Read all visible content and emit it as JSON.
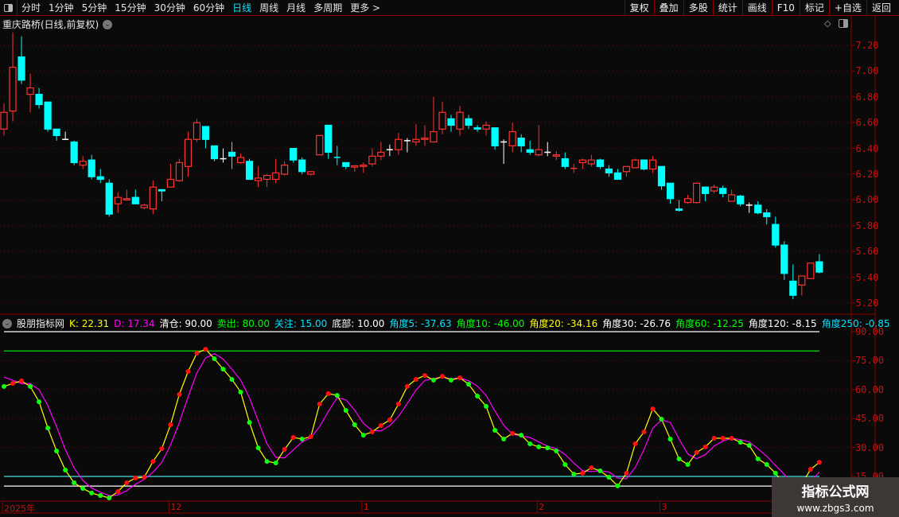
{
  "toolbar": {
    "periods": [
      "分时",
      "1分钟",
      "5分钟",
      "15分钟",
      "30分钟",
      "60分钟",
      "日线",
      "周线",
      "月线",
      "多周期",
      "更多 >"
    ],
    "active_index": 6,
    "right_buttons": [
      "复权",
      "叠加",
      "多股",
      "统计",
      "画线",
      "F10",
      "标记",
      "+自选",
      "返回"
    ]
  },
  "title": {
    "text": "重庆路桥(日线,前复权)"
  },
  "indicator": {
    "name": "股朋指标网",
    "items": [
      {
        "label": "K: 22.31",
        "color": "#ffff00"
      },
      {
        "label": "D: 17.34",
        "color": "#ff00ff"
      },
      {
        "label": "清仓: 90.00",
        "color": "#ffffff"
      },
      {
        "label": "卖出:",
        "color": "#00ff00",
        "value": "80.00"
      },
      {
        "label": "关注: 15.00",
        "color": "#00e5ff"
      },
      {
        "label": "底部: 10.00",
        "color": "#ffffff"
      },
      {
        "label": "角度5: -37.63",
        "color": "#00e5ff"
      },
      {
        "label": "角度10: -46.00",
        "color": "#00ff00"
      },
      {
        "label": "角度20: -34.16",
        "color": "#ffff00"
      },
      {
        "label": "角度30: -26.76",
        "color": "#ffffff"
      },
      {
        "label": "角度60: -12.25",
        "color": "#00ff00"
      },
      {
        "label": "角度120: -8.15",
        "color": "#ffffff"
      },
      {
        "label": "角度250: -0.85",
        "color": "#00e5ff"
      }
    ]
  },
  "watermark": {
    "line1": "指标公式网",
    "line2": "www.zbgs3.com"
  },
  "colors": {
    "up": "#ff3232",
    "down": "#00ffff",
    "flat": "#ffffff",
    "k": "#ffff00",
    "d": "#ff00ff",
    "grid": "#7a0000"
  },
  "chart_data": [
    {
      "type": "candlestick",
      "title": "重庆路桥(日线,前复权)",
      "ylim": [
        5.15,
        7.35
      ],
      "yticks": [
        "7.20",
        "7.00",
        "6.80",
        "6.60",
        "6.40",
        "6.20",
        "6.00",
        "5.80",
        "5.60",
        "5.40",
        "5.20"
      ],
      "x_labels": [
        {
          "index": 0,
          "text": "2025年"
        },
        {
          "index": 19,
          "text": "12"
        },
        {
          "index": 41,
          "text": "1"
        },
        {
          "index": 61,
          "text": "2"
        },
        {
          "index": 75,
          "text": "3"
        }
      ],
      "ohlc": [
        [
          6.55,
          6.75,
          6.5,
          6.68
        ],
        [
          6.69,
          7.3,
          6.61,
          7.03
        ],
        [
          7.11,
          7.27,
          6.9,
          6.93
        ],
        [
          6.82,
          6.98,
          6.68,
          6.87
        ],
        [
          6.82,
          6.87,
          6.71,
          6.74
        ],
        [
          6.76,
          6.76,
          6.53,
          6.55
        ],
        [
          6.55,
          6.55,
          6.46,
          6.5
        ],
        [
          6.47,
          6.53,
          6.47,
          6.47
        ],
        [
          6.45,
          6.46,
          6.27,
          6.29
        ],
        [
          6.27,
          6.34,
          6.24,
          6.3
        ],
        [
          6.31,
          6.35,
          6.16,
          6.18
        ],
        [
          6.18,
          6.24,
          6.13,
          6.16
        ],
        [
          6.13,
          6.16,
          5.87,
          5.89
        ],
        [
          5.97,
          6.06,
          5.9,
          6.02
        ],
        [
          6.0,
          6.08,
          6.0,
          6.01
        ],
        [
          6.02,
          6.08,
          5.97,
          5.97
        ],
        [
          5.94,
          5.97,
          5.93,
          5.96
        ],
        [
          5.93,
          6.15,
          5.89,
          6.1
        ],
        [
          6.08,
          6.08,
          5.99,
          6.07
        ],
        [
          6.1,
          6.28,
          6.1,
          6.16
        ],
        [
          6.15,
          6.32,
          6.14,
          6.29
        ],
        [
          6.26,
          6.53,
          6.18,
          6.47
        ],
        [
          6.47,
          6.63,
          6.45,
          6.6
        ],
        [
          6.57,
          6.57,
          6.4,
          6.47
        ],
        [
          6.42,
          6.42,
          6.3,
          6.32
        ],
        [
          6.32,
          6.4,
          6.29,
          6.32
        ],
        [
          6.37,
          6.45,
          6.24,
          6.34
        ],
        [
          6.29,
          6.36,
          6.28,
          6.33
        ],
        [
          6.3,
          6.32,
          6.16,
          6.16
        ],
        [
          6.15,
          6.26,
          6.1,
          6.17
        ],
        [
          6.16,
          6.2,
          6.1,
          6.19
        ],
        [
          6.16,
          6.32,
          6.13,
          6.21
        ],
        [
          6.2,
          6.3,
          6.19,
          6.27
        ],
        [
          6.4,
          6.4,
          6.29,
          6.31
        ],
        [
          6.31,
          6.33,
          6.2,
          6.22
        ],
        [
          6.2,
          6.22,
          6.19,
          6.22
        ],
        [
          6.35,
          6.5,
          6.35,
          6.5
        ],
        [
          6.58,
          6.58,
          6.32,
          6.37
        ],
        [
          6.33,
          6.42,
          6.27,
          6.325
        ],
        [
          6.29,
          6.29,
          6.24,
          6.26
        ],
        [
          6.255,
          6.27,
          6.22,
          6.265
        ],
        [
          6.26,
          6.29,
          6.21,
          6.27
        ],
        [
          6.28,
          6.4,
          6.26,
          6.34
        ],
        [
          6.34,
          6.45,
          6.31,
          6.37
        ],
        [
          6.39,
          6.43,
          6.34,
          6.39
        ],
        [
          6.39,
          6.52,
          6.35,
          6.47
        ],
        [
          6.46,
          6.48,
          6.37,
          6.46
        ],
        [
          6.45,
          6.59,
          6.42,
          6.47
        ],
        [
          6.47,
          6.58,
          6.42,
          6.48
        ],
        [
          6.45,
          6.8,
          6.45,
          6.53
        ],
        [
          6.55,
          6.76,
          6.51,
          6.68
        ],
        [
          6.63,
          6.66,
          6.53,
          6.58
        ],
        [
          6.55,
          6.73,
          6.5,
          6.68
        ],
        [
          6.63,
          6.66,
          6.55,
          6.58
        ],
        [
          6.56,
          6.58,
          6.53,
          6.55
        ],
        [
          6.55,
          6.61,
          6.5,
          6.58
        ],
        [
          6.56,
          6.56,
          6.39,
          6.42
        ],
        [
          6.45,
          6.47,
          6.28,
          6.45
        ],
        [
          6.42,
          6.6,
          6.37,
          6.53
        ],
        [
          6.48,
          6.51,
          6.37,
          6.42
        ],
        [
          6.39,
          6.46,
          6.35,
          6.37
        ],
        [
          6.35,
          6.58,
          6.34,
          6.39
        ],
        [
          6.37,
          6.45,
          6.34,
          6.37
        ],
        [
          6.34,
          6.38,
          6.31,
          6.35
        ],
        [
          6.32,
          6.37,
          6.24,
          6.26
        ],
        [
          6.24,
          6.28,
          6.21,
          6.245
        ],
        [
          6.29,
          6.32,
          6.24,
          6.31
        ],
        [
          6.28,
          6.35,
          6.26,
          6.31
        ],
        [
          6.31,
          6.32,
          6.24,
          6.26
        ],
        [
          6.24,
          6.27,
          6.18,
          6.21
        ],
        [
          6.21,
          6.24,
          6.16,
          6.16
        ],
        [
          6.22,
          6.26,
          6.18,
          6.26
        ],
        [
          6.25,
          6.32,
          6.25,
          6.31
        ],
        [
          6.31,
          6.31,
          6.23,
          6.24
        ],
        [
          6.24,
          6.34,
          6.21,
          6.31
        ],
        [
          6.26,
          6.26,
          6.08,
          6.11
        ],
        [
          6.13,
          6.13,
          5.97,
          6.01
        ],
        [
          5.93,
          6.0,
          5.91,
          5.92
        ],
        [
          5.98,
          6.04,
          5.97,
          6.01
        ],
        [
          5.98,
          6.13,
          5.97,
          6.13
        ],
        [
          6.1,
          6.1,
          5.99,
          6.05
        ],
        [
          6.07,
          6.12,
          6.05,
          6.1
        ],
        [
          6.09,
          6.11,
          6.02,
          6.05
        ],
        [
          5.99,
          6.08,
          5.99,
          6.04
        ],
        [
          6.03,
          6.04,
          5.95,
          5.97
        ],
        [
          5.96,
          5.98,
          5.9,
          5.96
        ],
        [
          5.96,
          5.99,
          5.89,
          5.9
        ],
        [
          5.9,
          5.93,
          5.81,
          5.87
        ],
        [
          5.81,
          5.87,
          5.63,
          5.65
        ],
        [
          5.65,
          5.68,
          5.38,
          5.43
        ],
        [
          5.37,
          5.5,
          5.23,
          5.26
        ],
        [
          5.34,
          5.41,
          5.26,
          5.41
        ],
        [
          5.39,
          5.51,
          5.39,
          5.51
        ],
        [
          5.52,
          5.58,
          5.43,
          5.44
        ]
      ]
    },
    {
      "type": "line",
      "title": "股朋指标网",
      "ylim": [
        0,
        95
      ],
      "yticks": [
        "90.00",
        "75.00",
        "60.00",
        "45.00",
        "30.00",
        "15.00"
      ],
      "hlines": [
        {
          "value": 90,
          "color": "#ffffff"
        },
        {
          "value": 80,
          "color": "#00e000"
        },
        {
          "value": 15,
          "color": "#40e0e0"
        },
        {
          "value": 10,
          "color": "#ffffff"
        }
      ],
      "series": [
        {
          "name": "K",
          "values": [
            61.6,
            63.2,
            64.5,
            61.6,
            53.7,
            40.1,
            28.2,
            18.3,
            11.7,
            8.8,
            6.4,
            5.1,
            3.9,
            7.2,
            11.7,
            14.2,
            14.6,
            22.8,
            29.4,
            41.8,
            57.5,
            69.4,
            78.9,
            80.9,
            76.0,
            70.6,
            65.3,
            58.7,
            43.0,
            29.8,
            22.8,
            22.0,
            29.0,
            35.2,
            34.4,
            35.6,
            52.5,
            57.9,
            57.0,
            49.2,
            41.8,
            36.4,
            38.1,
            41.4,
            44.3,
            52.5,
            61.6,
            65.3,
            67.3,
            64.9,
            66.9,
            64.9,
            66.1,
            62.8,
            56.6,
            51.3,
            38.9,
            34.4,
            37.3,
            36.4,
            31.9,
            30.3,
            29.8,
            28.2,
            21.2,
            16.2,
            16.7,
            19.5,
            17.9,
            14.6,
            10.1,
            16.7,
            31.9,
            38.1,
            50.0,
            44.7,
            34.4,
            24.1,
            21.2,
            27.4,
            30.3,
            34.8,
            34.8,
            34.8,
            32.7,
            31.1,
            24.1,
            21.2,
            16.7,
            10.5,
            7.0,
            11.0,
            18.7,
            22.31
          ]
        },
        {
          "name": "D",
          "values": [
            66.5,
            64.8,
            63.1,
            63.1,
            59.9,
            51.8,
            40.7,
            28.9,
            19.4,
            12.9,
            9.0,
            6.8,
            5.1,
            5.4,
            7.6,
            11.0,
            13.5,
            17.2,
            22.3,
            31.3,
            42.9,
            56.2,
            68.6,
            76.4,
            78.6,
            75.8,
            70.6,
            64.9,
            55.7,
            43.8,
            31.9,
            24.9,
            24.6,
            28.7,
            32.9,
            35.1,
            40.8,
            48.7,
            55.8,
            54.7,
            49.3,
            42.5,
            38.8,
            38.6,
            41.3,
            46.1,
            52.8,
            59.8,
            64.7,
            65.8,
            66.4,
            65.6,
            66.0,
            64.6,
            61.8,
            56.9,
            48.9,
            41.5,
            36.9,
            36.0,
            35.2,
            32.9,
            30.7,
            29.4,
            26.4,
            21.9,
            18.0,
            17.5,
            18.0,
            17.3,
            14.2,
            13.8,
            19.6,
            28.9,
            40.0,
            44.3,
            43.0,
            34.4,
            26.6,
            24.2,
            26.3,
            30.8,
            33.3,
            34.8,
            34.1,
            32.9,
            29.3,
            25.5,
            20.7,
            16.1,
            11.4,
            9.5,
            12.2,
            17.34
          ]
        }
      ]
    }
  ]
}
